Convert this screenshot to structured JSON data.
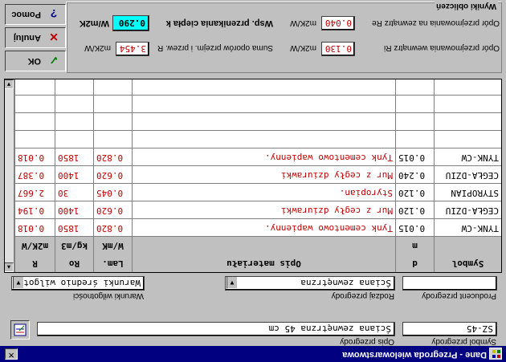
{
  "window": {
    "title": "Dane - Przegroda wielowarstwowa",
    "close_glyph": "✕"
  },
  "form": {
    "symbol_label": "Symbol przegrody",
    "symbol_value": "SZ-45",
    "opis_label": "Opis przegrody",
    "opis_value": "Ściana zewnętrzna 45 cm",
    "producent_label": "Producent przegrody",
    "producent_value": "",
    "rodzaj_label": "Rodzaj przegrody",
    "rodzaj_value": "Ściana zewnętrzna",
    "warunki_label": "Warunki wilgotności",
    "warunki_value": "Warunki średnio wilgotne"
  },
  "table": {
    "headers_row1": [
      "Symbol",
      "d",
      "Opis materiału",
      "Lam.",
      "Ro",
      "R"
    ],
    "headers_row2": [
      "",
      "m",
      "",
      "W/mK",
      "kg/m3",
      "m2K/W"
    ],
    "rows": [
      [
        "TYNK-CW",
        "0.015",
        "Tynk cementowo wapienny.",
        "0.820",
        "1850",
        "0.018"
      ],
      [
        "CEGŁA-DZIU",
        "0.120",
        "Mur z cegły dziurawki",
        "0.620",
        "1400",
        "0.194"
      ],
      [
        "STYROPIAN",
        "0.120",
        "Styropian.",
        "0.045",
        "30",
        "2.667"
      ],
      [
        "CEGŁA-DZIU",
        "0.240",
        "Mur z cegły dziurawki",
        "0.620",
        "1400",
        "0.387"
      ],
      [
        "TYNK-CW",
        "0.015",
        "Tynk cementowo wapienny.",
        "0.820",
        "1850",
        "0.018"
      ],
      [
        "",
        "",
        "",
        "",
        "",
        ""
      ],
      [
        "",
        "",
        "",
        "",
        "",
        ""
      ],
      [
        "",
        "",
        "",
        "",
        "",
        ""
      ],
      [
        "",
        "",
        "",
        "",
        "",
        ""
      ]
    ]
  },
  "results": {
    "group_title": "Wyniki obliczeń",
    "ri_label": "Opór przejmowania wewnątrz Ri",
    "ri_value": "0.130",
    "ri_unit": "m2K/W",
    "sum_label": "Suma oporów przejm. i przew. R",
    "sum_value": "3.454",
    "sum_unit": "m2K/W",
    "re_label": "Opór przejmowania na zewnątrz Re",
    "re_value": "0.040",
    "re_unit": "m2K/W",
    "k_label": "Wsp. przenikania ciepła k",
    "k_value": "0.290",
    "k_unit": "W/m2K"
  },
  "buttons": {
    "ok_label": "OK",
    "cancel_label": "Anuluj",
    "help_label": "Pomoc"
  },
  "colors": {
    "title_bar": "#000080",
    "value_red": "#c00000",
    "k_highlight": "#00ffff"
  }
}
